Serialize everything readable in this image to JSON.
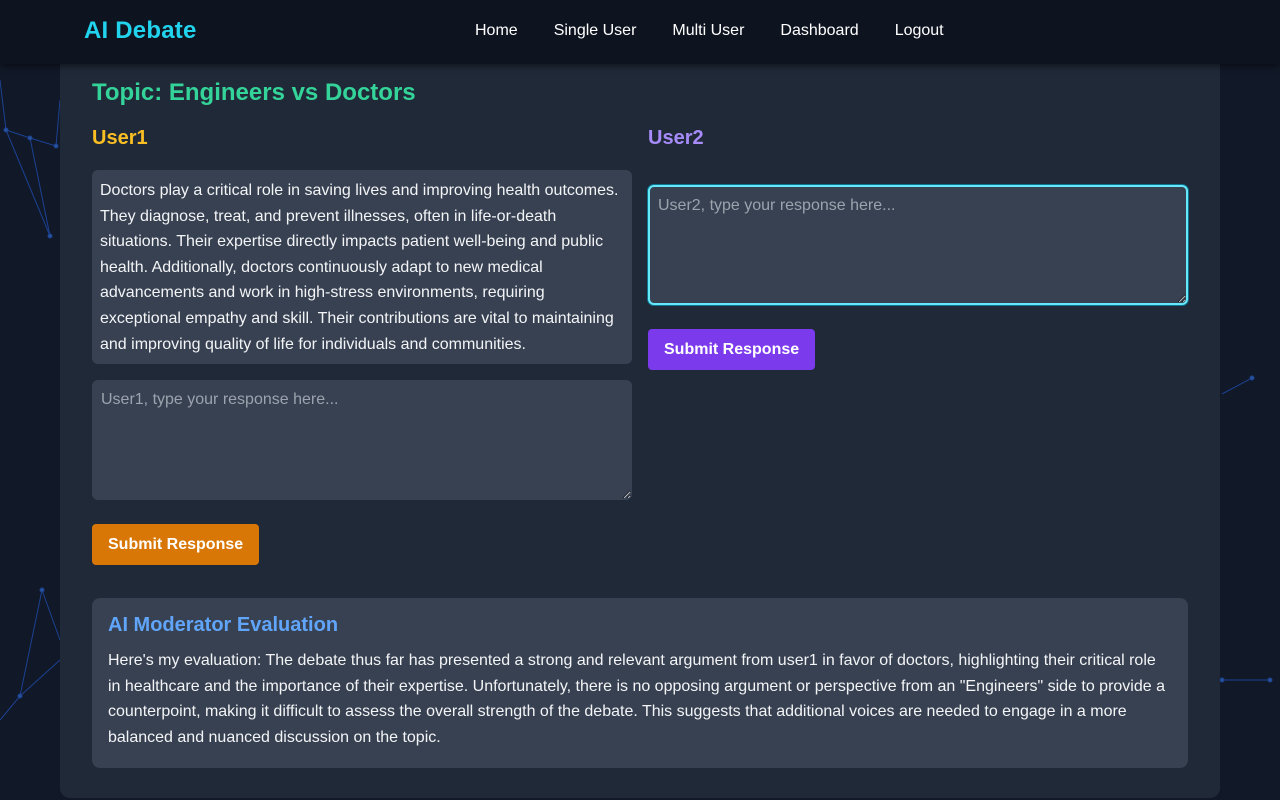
{
  "navbar": {
    "brand": "AI Debate",
    "links": [
      "Home",
      "Single User",
      "Multi User",
      "Dashboard",
      "Logout"
    ]
  },
  "debate": {
    "topic": "Topic: Engineers vs Doctors",
    "user1": {
      "name": "User1",
      "argument": "Doctors play a critical role in saving lives and improving health outcomes. They diagnose, treat, and prevent illnesses, often in life-or-death situations. Their expertise directly impacts patient well-being and public health. Additionally, doctors continuously adapt to new medical advancements and work in high-stress environments, requiring exceptional empathy and skill. Their contributions are vital to maintaining and improving quality of life for individuals and communities.",
      "placeholder": "User1, type your response here...",
      "input_value": "",
      "submit_label": "Submit Response"
    },
    "user2": {
      "name": "User2",
      "placeholder": "User2, type your response here...",
      "input_value": "",
      "submit_label": "Submit Response"
    }
  },
  "moderator": {
    "title": "AI Moderator Evaluation",
    "text": "Here's my evaluation: The debate thus far has presented a strong and relevant argument from user1 in favor of doctors, highlighting their critical role in healthcare and the importance of their expertise. Unfortunately, there is no opposing argument or perspective from an \"Engineers\" side to provide a counterpoint, making it difficult to assess the overall strength of the debate. This suggests that additional voices are needed to engage in a more balanced and nuanced discussion on the topic."
  },
  "colors": {
    "brand": "#22d3ee",
    "topic": "#34d399",
    "user1": "#fbbf24",
    "user2": "#a78bfa",
    "user1_button": "#d97706",
    "user2_button": "#7c3aed",
    "moderator_title": "#60a5fa",
    "focus_ring": "#67e8f9"
  }
}
